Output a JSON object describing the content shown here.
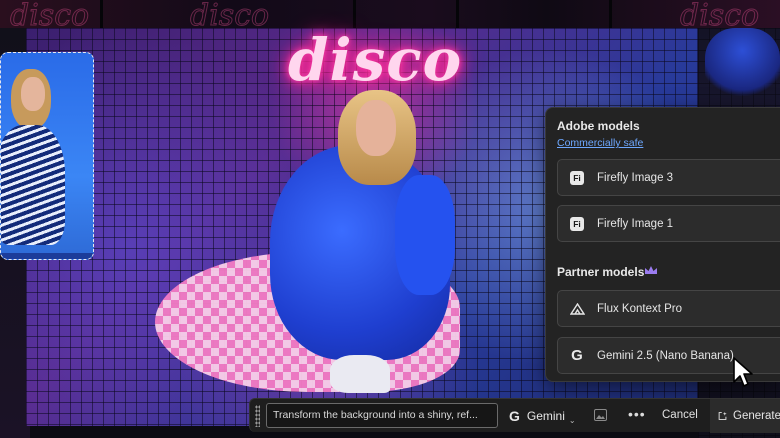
{
  "background": {
    "neon_sign_text": "disco"
  },
  "model_menu": {
    "adobe_section_title": "Adobe models",
    "adobe_section_link": "Commercially safe",
    "adobe_models": [
      {
        "label": "Firefly Image 3",
        "icon": "firefly-icon",
        "icon_text": "Fi"
      },
      {
        "label": "Firefly Image 1",
        "icon": "firefly-icon",
        "icon_text": "Fi"
      }
    ],
    "partner_section_title": "Partner models",
    "partner_badge_icon": "crown-icon",
    "partner_models": [
      {
        "label": "Flux Kontext Pro",
        "icon": "flux-icon"
      },
      {
        "label": "Gemini 2.5 (Nano Banana)",
        "icon": "google-icon",
        "icon_text": "G"
      }
    ],
    "hovered_item": "Gemini 2.5 (Nano Banana)"
  },
  "prompt_bar": {
    "prompt_text": "Transform the background into a shiny, ref...",
    "model_icon_text": "G",
    "selected_model": "Gemini",
    "more_label": "•••",
    "cancel_label": "Cancel",
    "generate_label": "Generate"
  },
  "colors": {
    "panel_bg": "#232323",
    "item_bg": "#2c2c2c",
    "link": "#6ea8ff",
    "crown": "#9b7cf0",
    "neon": "#ff3fa8"
  }
}
